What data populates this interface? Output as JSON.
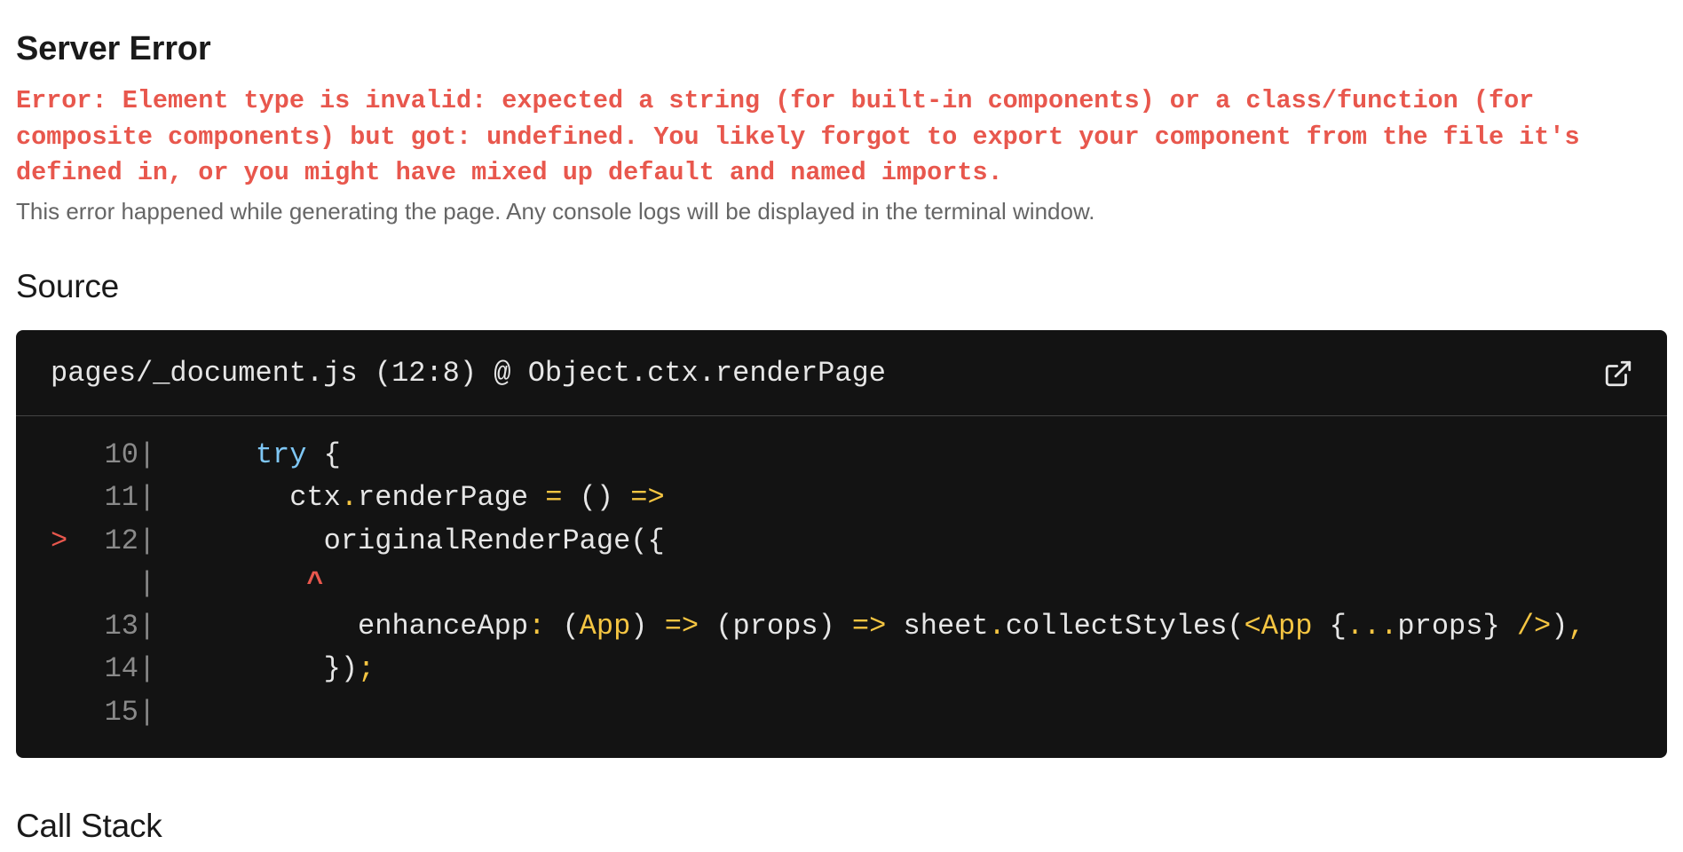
{
  "header": {
    "title": "Server Error",
    "message": "Error: Element type is invalid: expected a string (for built-in components) or a class/function (for composite components) but got: undefined. You likely forgot to export your component from the file it's defined in, or you might have mixed up default and named imports.",
    "note": "This error happened while generating the page. Any console logs will be displayed in the terminal window."
  },
  "source": {
    "heading": "Source",
    "file_location": "pages/_document.js (12:8) @ Object.ctx.renderPage",
    "open_icon": "external-link-icon",
    "marker": ">",
    "gutter": "|",
    "caret": "^",
    "lines": [
      {
        "no": "10",
        "tokens": [
          {
            "t": "    ",
            "c": "txt"
          },
          {
            "t": "try",
            "c": "kw"
          },
          {
            "t": " {",
            "c": "txt"
          }
        ]
      },
      {
        "no": "11",
        "tokens": [
          {
            "t": "      ctx",
            "c": "txt"
          },
          {
            "t": ".",
            "c": "op"
          },
          {
            "t": "renderPage ",
            "c": "txt"
          },
          {
            "t": "=",
            "c": "op"
          },
          {
            "t": " () ",
            "c": "txt"
          },
          {
            "t": "=>",
            "c": "op"
          }
        ]
      },
      {
        "no": "12",
        "marked": true,
        "tokens": [
          {
            "t": "        originalRenderPage({",
            "c": "txt"
          }
        ]
      },
      {
        "no": "",
        "caret_line": true,
        "tokens": [
          {
            "t": "       ",
            "c": "txt"
          },
          {
            "t": "^",
            "c": "caret"
          }
        ]
      },
      {
        "no": "13",
        "tokens": [
          {
            "t": "          enhanceApp",
            "c": "txt"
          },
          {
            "t": ":",
            "c": "op"
          },
          {
            "t": " (",
            "c": "txt"
          },
          {
            "t": "App",
            "c": "op"
          },
          {
            "t": ") ",
            "c": "txt"
          },
          {
            "t": "=>",
            "c": "op"
          },
          {
            "t": " (props) ",
            "c": "txt"
          },
          {
            "t": "=>",
            "c": "op"
          },
          {
            "t": " sheet",
            "c": "txt"
          },
          {
            "t": ".",
            "c": "op"
          },
          {
            "t": "collectStyles(",
            "c": "txt"
          },
          {
            "t": "<App",
            "c": "op"
          },
          {
            "t": " {",
            "c": "txt"
          },
          {
            "t": "...",
            "c": "op"
          },
          {
            "t": "props} ",
            "c": "txt"
          },
          {
            "t": "/>",
            "c": "op"
          },
          {
            "t": ")",
            "c": "txt"
          },
          {
            "t": ",",
            "c": "op"
          }
        ]
      },
      {
        "no": "14",
        "tokens": [
          {
            "t": "        })",
            "c": "txt"
          },
          {
            "t": ";",
            "c": "op"
          }
        ]
      },
      {
        "no": "15",
        "tokens": []
      }
    ]
  },
  "call_stack": {
    "heading": "Call Stack"
  }
}
